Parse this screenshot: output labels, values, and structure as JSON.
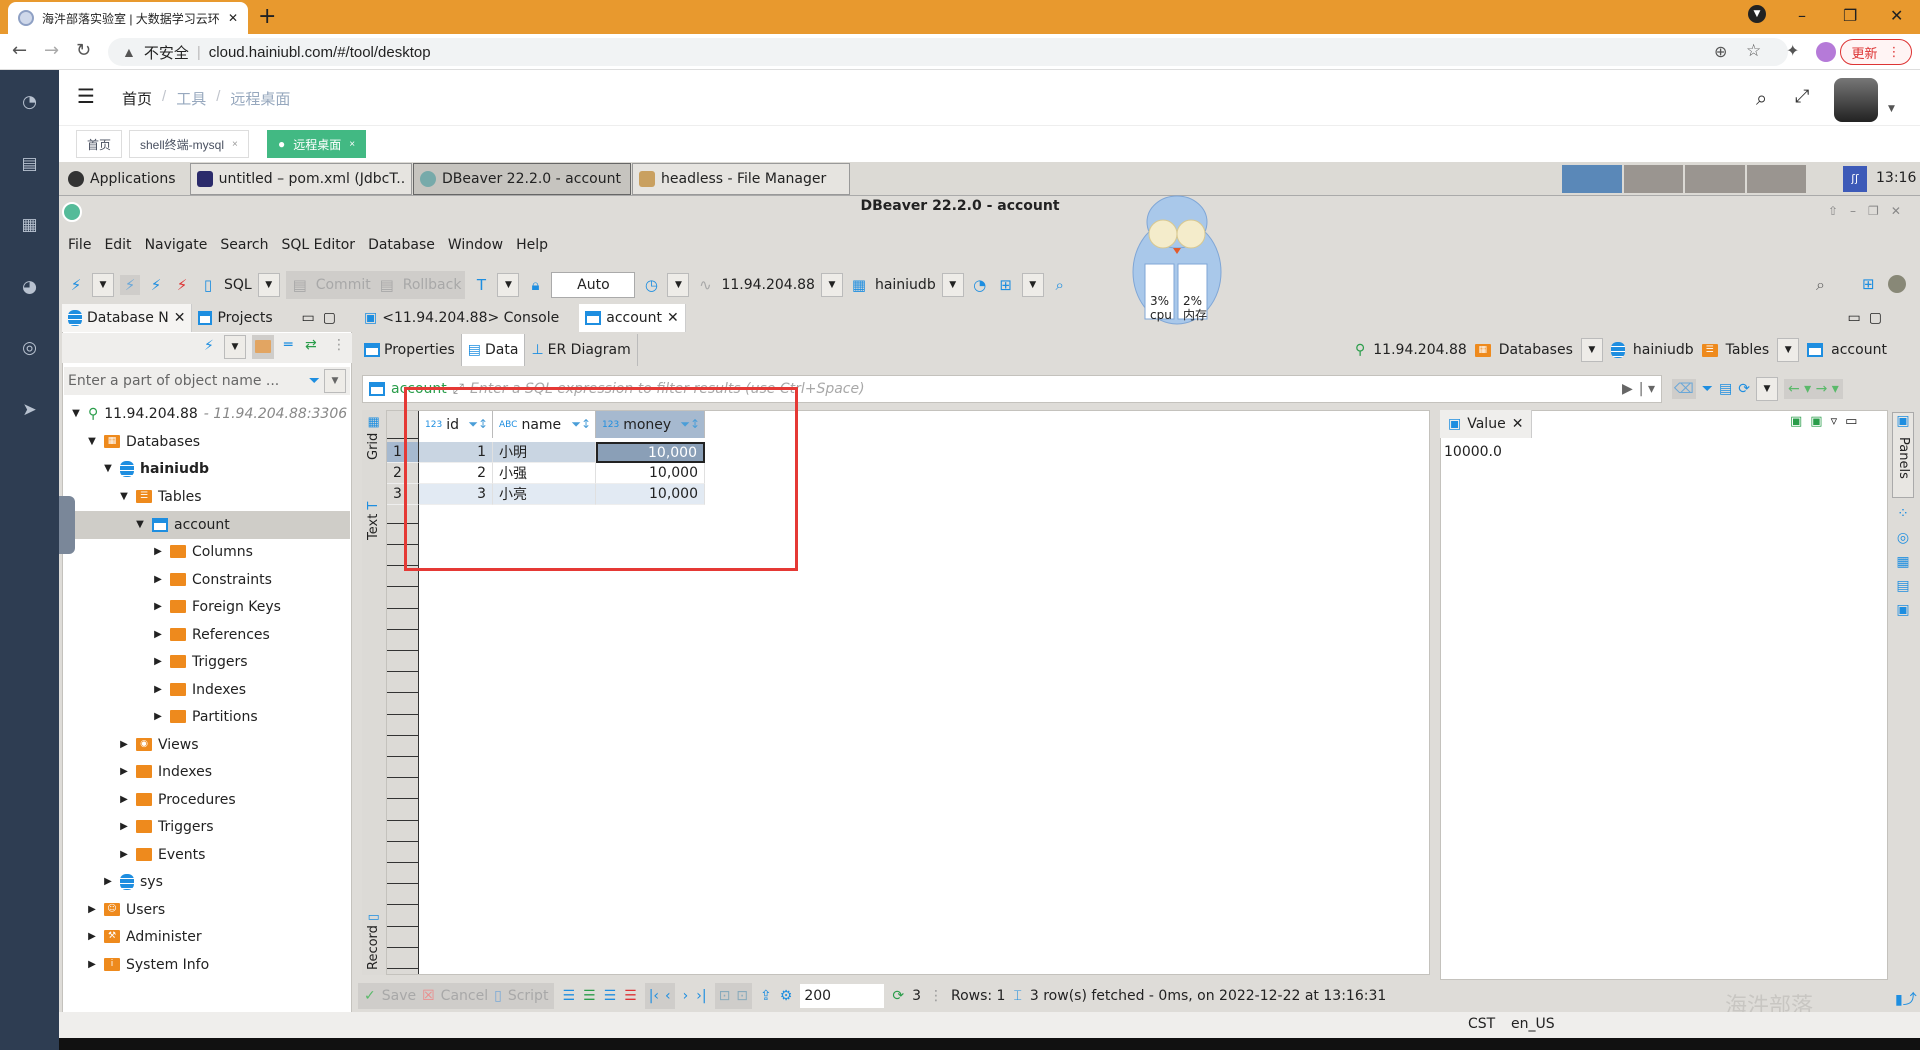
{
  "browser": {
    "tab_title": "海汼部落实验室 | 大数据学习云环",
    "url_warning": "不安全",
    "url": "cloud.hainiubl.com/#/tool/desktop",
    "update_label": "更新"
  },
  "app": {
    "breadcrumb": [
      "首页",
      "工具",
      "远程桌面"
    ],
    "tags": [
      {
        "label": "首页",
        "closable": false,
        "active": false
      },
      {
        "label": "shell终端-mysql",
        "closable": true,
        "active": false
      },
      {
        "label": "远程桌面",
        "closable": true,
        "active": true
      }
    ],
    "sidebar_icons": [
      "dashboard-icon",
      "document-icon",
      "apps-icon",
      "globe-icon",
      "lifebuoy-icon",
      "paper-plane-icon"
    ]
  },
  "taskbar": {
    "applications_label": "Applications",
    "windows": [
      {
        "label": "untitled – pom.xml (JdbcT...",
        "active": false
      },
      {
        "label": "DBeaver 22.2.0 - account",
        "active": true
      },
      {
        "label": "headless - File Manager",
        "active": false
      }
    ],
    "clock": "13:16"
  },
  "monitor": {
    "cpu": "3%",
    "cpu_label": "cpu",
    "mem": "2%",
    "mem_label": "内存"
  },
  "dbeaver": {
    "title": "DBeaver 22.2.0 - account",
    "menu": [
      "File",
      "Edit",
      "Navigate",
      "Search",
      "SQL Editor",
      "Database",
      "Window",
      "Help"
    ],
    "toolbar": {
      "sql_label": "SQL",
      "commit_label": "Commit",
      "rollback_label": "Rollback",
      "transaction_mode": "Auto",
      "connection": "11.94.204.88",
      "database": "hainiudb"
    },
    "nav_tabs": [
      "Database N",
      "Projects"
    ],
    "nav_filter_placeholder": "Enter a part of object name ...",
    "tree": {
      "connection": "11.94.204.88",
      "connection_detail": "11.94.204.88:3306",
      "databases": "Databases",
      "db_name": "hainiudb",
      "tables": "Tables",
      "table": "account",
      "table_children": [
        "Columns",
        "Constraints",
        "Foreign Keys",
        "References",
        "Triggers",
        "Indexes",
        "Partitions"
      ],
      "db_children": [
        "Views",
        "Indexes",
        "Procedures",
        "Triggers",
        "Events"
      ],
      "other_db": "sys",
      "root_children": [
        "Users",
        "Administer",
        "System Info"
      ]
    },
    "editor_tabs": [
      "<11.94.204.88> Console",
      "account"
    ],
    "sub_tabs": [
      "Properties",
      "Data",
      "ER Diagram"
    ],
    "crumbs": [
      "11.94.204.88",
      "Databases",
      "hainiudb",
      "Tables",
      "account"
    ],
    "filter": {
      "table": "account",
      "placeholder": "Enter a SQL expression to filter results (use Ctrl+Space)"
    },
    "side_tabs": {
      "grid": "Grid",
      "text": "Text",
      "record": "Record"
    },
    "grid": {
      "columns": [
        {
          "type": "123",
          "name": "id"
        },
        {
          "type": "ABC",
          "name": "name"
        },
        {
          "type": "123",
          "name": "money"
        }
      ],
      "rows": [
        {
          "num": "1",
          "id": "1",
          "name": "小明",
          "money": "10,000"
        },
        {
          "num": "2",
          "id": "2",
          "name": "小强",
          "money": "10,000"
        },
        {
          "num": "3",
          "id": "3",
          "name": "小亮",
          "money": "10,000"
        }
      ]
    },
    "value_panel": {
      "title": "Value",
      "value": "10000.0",
      "panels_label": "Panels"
    },
    "bottom": {
      "save": "Save",
      "cancel": "Cancel",
      "script": "Script",
      "fetch_size": "200",
      "refresh_count": "3",
      "rows": "Rows: 1",
      "status": "3 row(s) fetched - 0ms, on 2022-12-22 at 13:16:31"
    },
    "status_line": {
      "timezone": "CST",
      "locale": "en_US"
    },
    "watermark": "海汼部落"
  }
}
